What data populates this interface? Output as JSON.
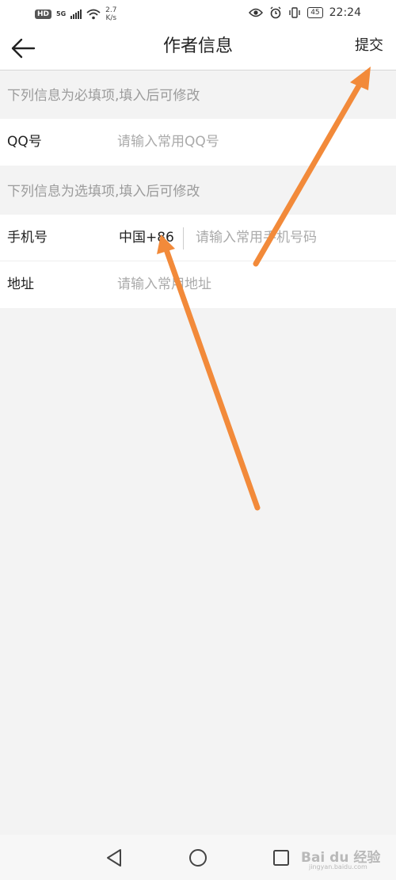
{
  "status_bar": {
    "hd": "HD",
    "network": "5G",
    "speed_value": "2.7",
    "speed_unit": "K/s",
    "battery": "45",
    "time": "22:24"
  },
  "header": {
    "title": "作者信息",
    "submit_label": "提交"
  },
  "required_section": {
    "hint": "下列信息为必填项,填入后可修改",
    "fields": [
      {
        "label": "QQ号",
        "placeholder": "请输入常用QQ号"
      }
    ]
  },
  "optional_section": {
    "hint": "下列信息为选填项,填入后可修改",
    "phone": {
      "label": "手机号",
      "country_code": "中国+86",
      "placeholder": "请输入常用手机号码"
    },
    "address": {
      "label": "地址",
      "placeholder": "请输入常用地址"
    }
  },
  "colors": {
    "background": "#f3f3f3",
    "hint_text": "#9b9b9b",
    "placeholder_text": "#aaaaaa",
    "annotation_arrow": "#f28a3a"
  },
  "watermark": {
    "text": "Bai du 经验",
    "sub": "jingyan.baidu.com"
  }
}
